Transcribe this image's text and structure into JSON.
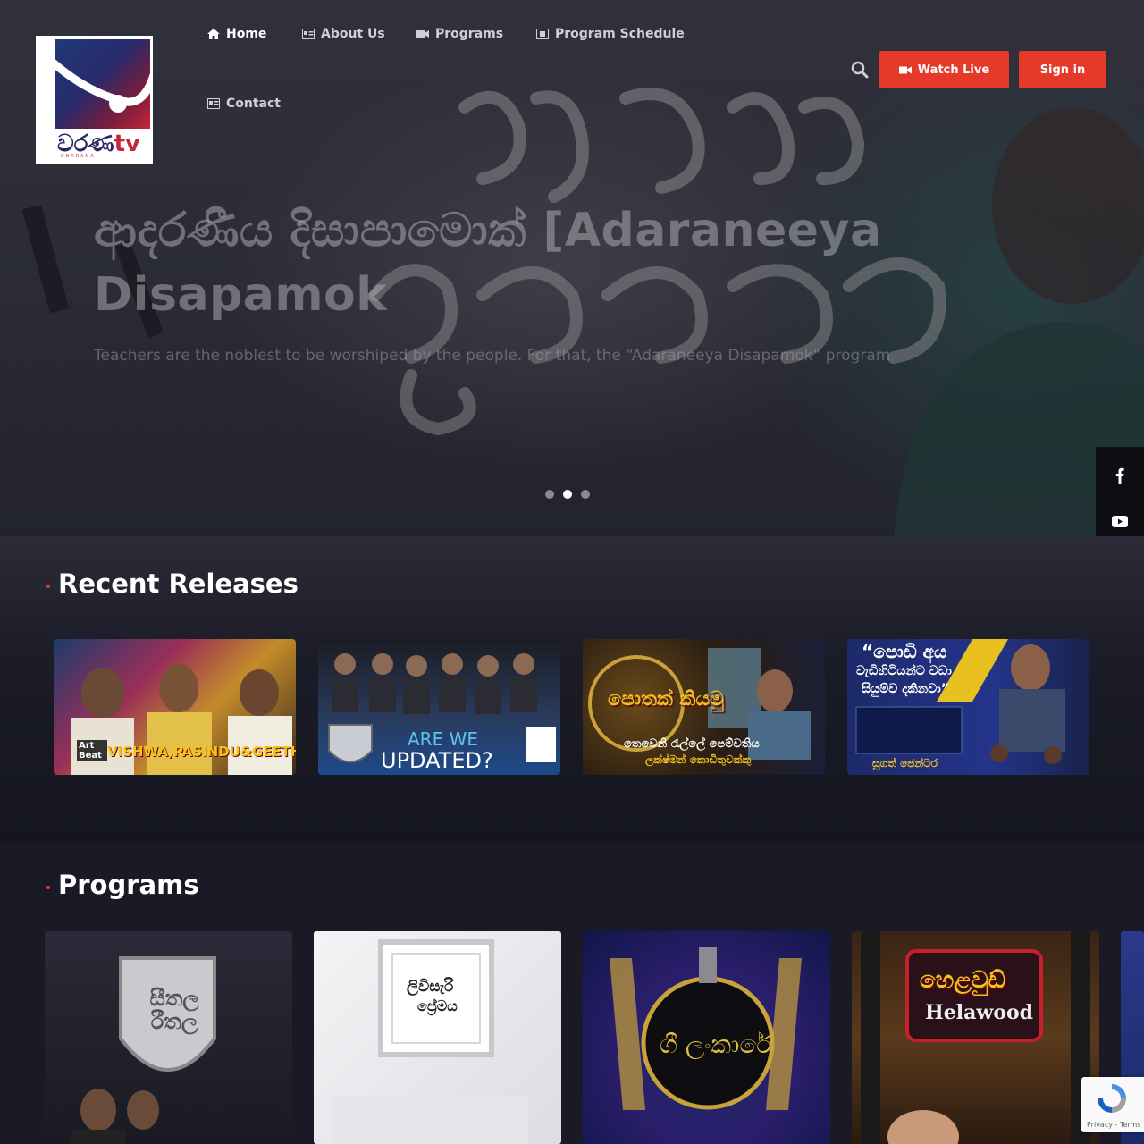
{
  "brand": {
    "logo_text": "වරණ",
    "logo_tv": "tv",
    "logo_subtext": "CHARANA"
  },
  "nav": {
    "items": [
      {
        "label": "Home",
        "icon": "home-icon"
      },
      {
        "label": "About Us",
        "icon": "id-card-icon"
      },
      {
        "label": "Programs",
        "icon": "video-camera-icon"
      },
      {
        "label": "Program Schedule",
        "icon": "film-icon"
      },
      {
        "label": "Contact",
        "icon": "address-card-icon"
      }
    ],
    "watch_live": "Watch Live",
    "sign_in": "Sign in"
  },
  "hero": {
    "title": "ආදරණීය දිසාපාමොක් [Adaraneeya Disapamok",
    "description": "Teachers are the noblest to be worshiped by the people. For that, the “Adaraneeya Disapamok” program",
    "slides": 3,
    "active_slide": 2
  },
  "social": [
    "facebook-icon",
    "youtube-icon",
    "instagram-icon",
    "tiktok-icon",
    "music-icon"
  ],
  "recent": {
    "title": "Recent Releases",
    "cards": [
      {
        "caption": "VISHWA,PASINDU&GEETH",
        "badge": "Art Beat"
      },
      {
        "caption_line1": "ARE WE",
        "caption_line2": "UPDATED?"
      },
      {
        "caption_line1": "පොතක් කියමු",
        "caption_line2": "තෙවෙනි රැල්ලේ පෙම්වතිය",
        "caption_line3": "ලක්ෂ්මන් කොඩිතුවක්කු"
      },
      {
        "caption_line1": "“පොඩි අය",
        "caption_line2": "වැඩිහිටියන්ට වඩා",
        "caption_line3": "සියුම්ව දකිනවා”",
        "caption_line4": "සුගත් ජෙන්ටර"
      }
    ]
  },
  "programs": {
    "title": "Programs",
    "cards": [
      {
        "name": "සීතල රීතල"
      },
      {
        "name_line1": "ලිවිසැරි",
        "name_line2": "ප්‍රේමය"
      },
      {
        "name": "ගී ලංකාරේ"
      },
      {
        "name_line1": "හෙළවුඩ්",
        "name_line2": "Helawood"
      }
    ]
  },
  "recaptcha": {
    "text": "Privacy - Terms"
  },
  "colors": {
    "accent": "#e53a2a",
    "background": "#14151f"
  }
}
